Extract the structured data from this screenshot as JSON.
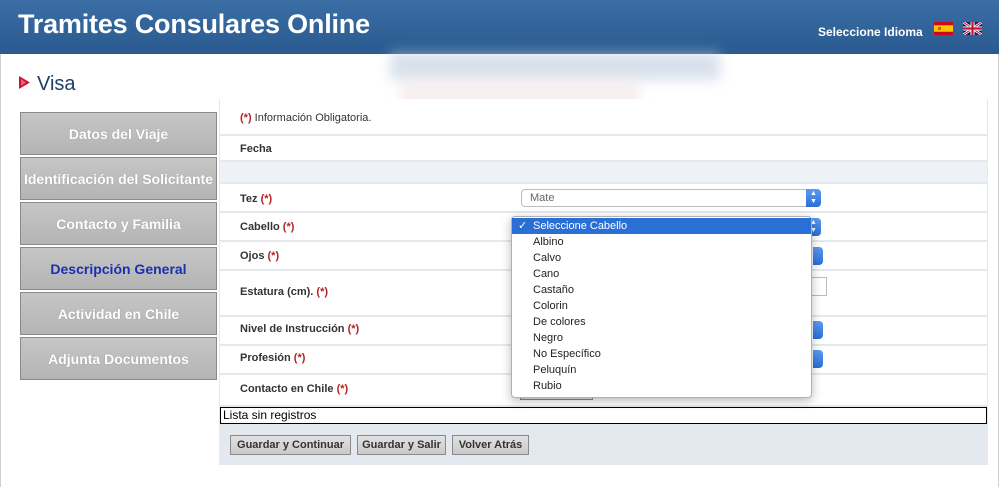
{
  "header": {
    "title": "Tramites Consulares Online",
    "language_label": "Seleccione Idioma",
    "flags": [
      "spanish-flag-icon",
      "uk-flag-icon"
    ]
  },
  "page": {
    "heading": "Visa",
    "heading_icon": "play-arrow-icon"
  },
  "sidebar": {
    "items": [
      {
        "label": "Datos del Viaje",
        "active": false
      },
      {
        "label": "Identificación del Solicitante",
        "active": false
      },
      {
        "label": "Contacto y Familia",
        "active": false
      },
      {
        "label": "Descripción General",
        "active": true
      },
      {
        "label": "Actividad en Chile",
        "active": false
      },
      {
        "label": "Adjunta Documentos",
        "active": false
      }
    ]
  },
  "form": {
    "required_mark": "(*)",
    "note_text": "Información Obligatoria.",
    "fecha_label": "Fecha",
    "fields": {
      "tez": {
        "label": "Tez",
        "value": "Mate"
      },
      "cabello": {
        "label": "Cabello",
        "value": "Seleccione Cabello"
      },
      "ojos": {
        "label": "Ojos"
      },
      "estatura": {
        "label": "Estatura (cm)."
      },
      "nivel": {
        "label": "Nivel de Instrucción"
      },
      "profesion": {
        "label": "Profesión"
      },
      "contacto": {
        "label": "Contacto en Chile"
      }
    },
    "empty_list": "Lista sin registros",
    "buttons": {
      "save_continue": "Guardar y Continuar",
      "save_exit": "Guardar y Salir",
      "back": "Volver Atrás"
    }
  },
  "dropdown": {
    "options": [
      "Seleccione Cabello",
      "Albino",
      "Calvo",
      "Cano",
      "Castaño",
      "Colorin",
      "De colores",
      "Negro",
      "No Específico",
      "Peluquín",
      "Rubio"
    ],
    "selected": "Seleccione Cabello",
    "check_icon": "checkmark-icon"
  },
  "colors": {
    "header": "#2f639a",
    "active_nav_text": "#1b2fb0",
    "required": "#b22222",
    "select_accent": "#2a6fd6"
  }
}
